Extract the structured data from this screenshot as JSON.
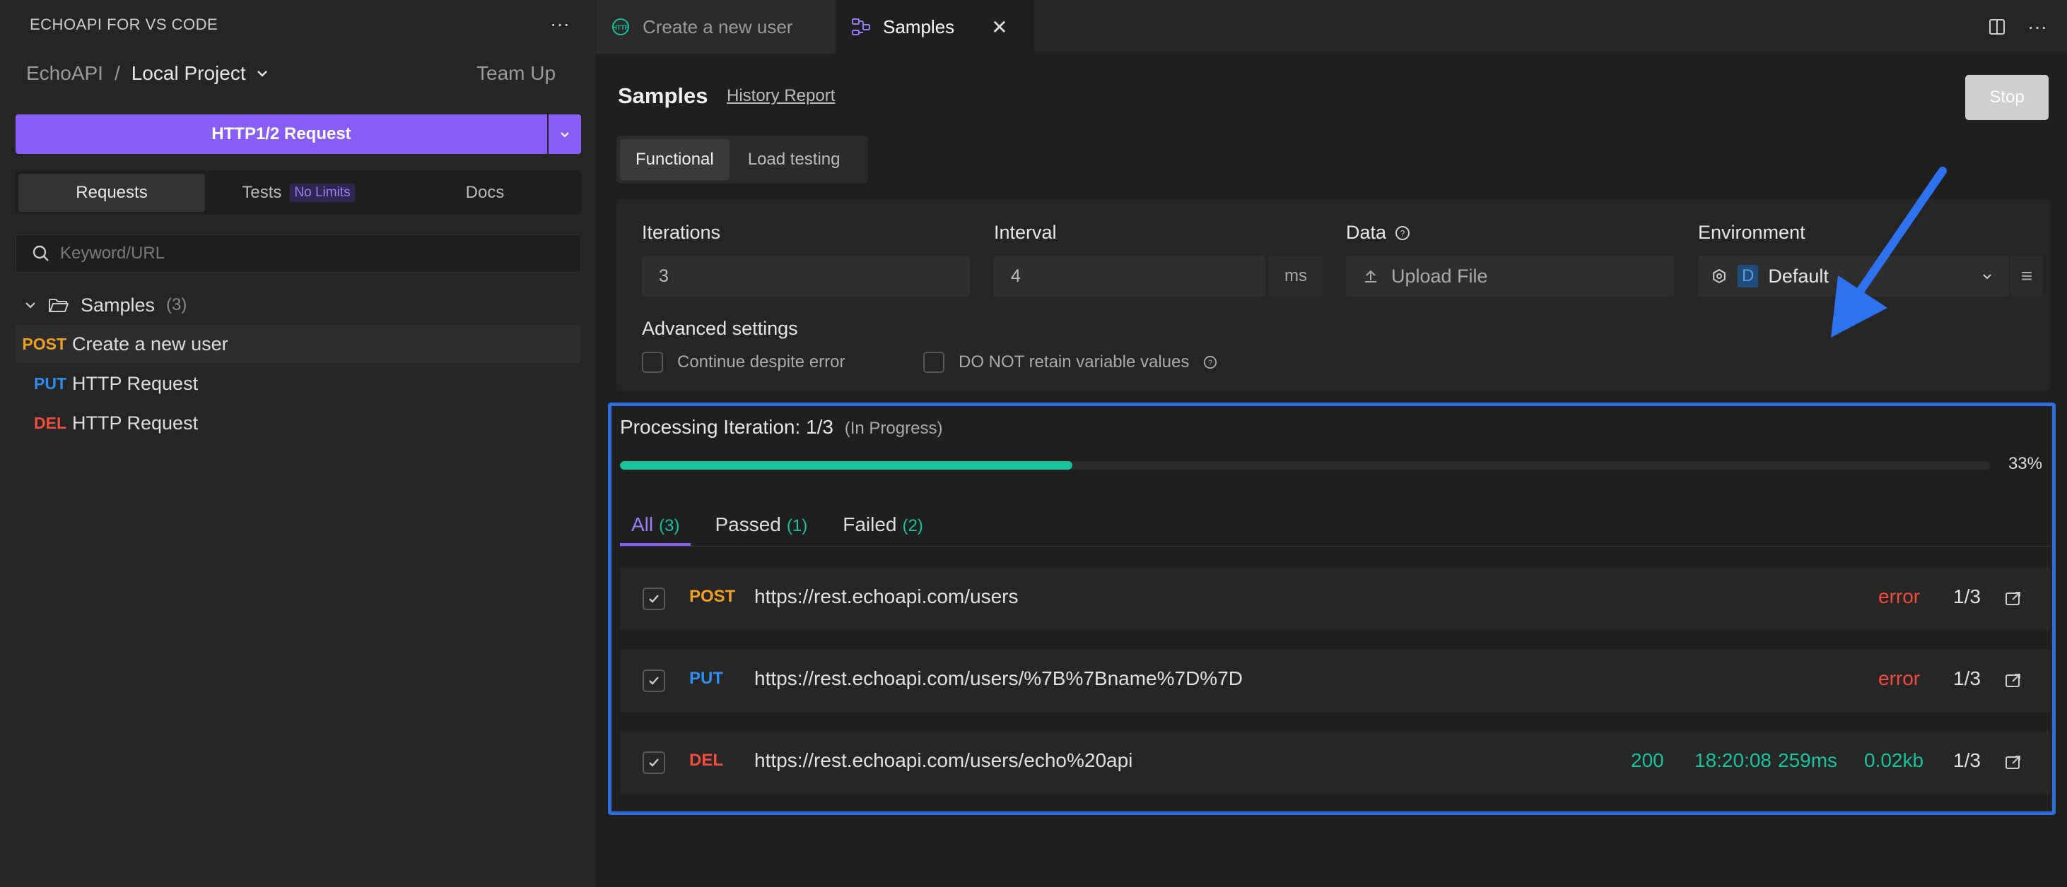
{
  "sidebar": {
    "title": "ECHOAPI FOR VS CODE",
    "more_label": "···",
    "breadcrumb": {
      "root": "EchoAPI",
      "separator": "/",
      "project": "Local Project"
    },
    "team_up": "Team Up",
    "request_button": "HTTP1/2 Request",
    "tabs": [
      {
        "label": "Requests"
      },
      {
        "label": "Tests",
        "badge": "No Limits"
      },
      {
        "label": "Docs"
      }
    ],
    "search_placeholder": "Keyword/URL",
    "folder": {
      "name": "Samples",
      "count": "(3)"
    },
    "items": [
      {
        "method": "POST",
        "name": "Create a new user"
      },
      {
        "method": "PUT",
        "name": "HTTP Request"
      },
      {
        "method": "DEL",
        "name": "HTTP Request"
      }
    ]
  },
  "tabbar": {
    "tabs": [
      {
        "label": "Create a new user",
        "icon": "http-icon"
      },
      {
        "label": "Samples",
        "icon": "samples-icon"
      }
    ]
  },
  "main": {
    "title": "Samples",
    "history_link": "History Report",
    "stop_button": "Stop",
    "modes": [
      "Functional",
      "Load testing"
    ],
    "config": {
      "iterations_label": "Iterations",
      "iterations_value": "3",
      "interval_label": "Interval",
      "interval_value": "4",
      "interval_unit": "ms",
      "data_label": "Data",
      "upload_label": "Upload File",
      "environment_label": "Environment",
      "environment_badge": "D",
      "environment_value": "Default",
      "advanced_label": "Advanced settings",
      "continue_label": "Continue despite error",
      "retain_label": "DO NOT retain variable values"
    },
    "results": {
      "processing_label": "Processing Iteration: 1/3",
      "status_label": "(In Progress)",
      "progress": 0.33,
      "progress_text": "33%",
      "filters": [
        {
          "label": "All",
          "count": "(3)"
        },
        {
          "label": "Passed",
          "count": "(1)"
        },
        {
          "label": "Failed",
          "count": "(2)"
        }
      ],
      "rows": [
        {
          "method": "POST",
          "url": "https://rest.echoapi.com/users",
          "status": "error",
          "iteration": "1/3"
        },
        {
          "method": "PUT",
          "url": "https://rest.echoapi.com/users/%7B%7Bname%7D%7D",
          "status": "error",
          "iteration": "1/3"
        },
        {
          "method": "DEL",
          "url": "https://rest.echoapi.com/users/echo%20api",
          "status": "200",
          "time": "18:20:08",
          "duration": "259ms",
          "size": "0.02kb",
          "iteration": "1/3"
        }
      ]
    }
  },
  "colors": {
    "accent": "#8a5cf6",
    "success": "#18c29c",
    "error": "#f24c3d",
    "post": "#f0a020",
    "put": "#2e8ef0",
    "highlight": "#2d6de0"
  }
}
